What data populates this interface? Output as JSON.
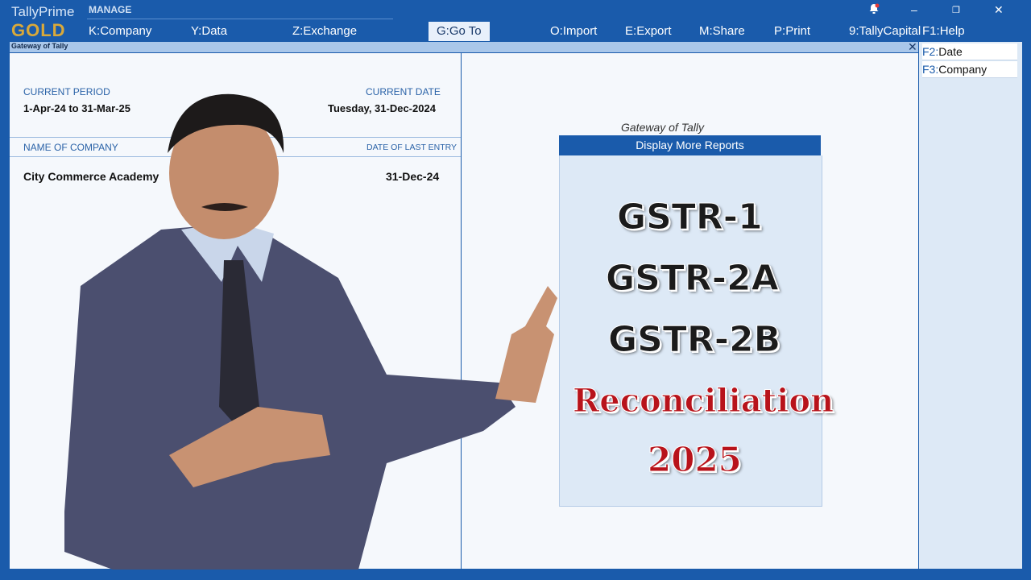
{
  "app": {
    "name": "TallyPrime",
    "edition": "GOLD"
  },
  "menu": {
    "section_label": "MANAGE",
    "items": [
      {
        "key": "K:",
        "label": "Company"
      },
      {
        "key": "Y:",
        "label": "Data"
      },
      {
        "key": "Z:",
        "label": "Exchange"
      },
      {
        "key": "G:",
        "label": "Go To"
      },
      {
        "key": "O:",
        "label": "Import"
      },
      {
        "key": "E:",
        "label": "Export"
      },
      {
        "key": "M:",
        "label": "Share"
      },
      {
        "key": "P:",
        "label": "Print"
      },
      {
        "key": "9:",
        "label": "TallyCapital"
      },
      {
        "key": "F1:",
        "label": "Help"
      }
    ]
  },
  "window_title": "Gateway of Tally",
  "right_panel": {
    "buttons": [
      {
        "key": "F2:",
        "label": "Date"
      },
      {
        "key": "F3:",
        "label": "Company"
      }
    ]
  },
  "left_panel": {
    "current_period_label": "CURRENT PERIOD",
    "current_period_value": "1-Apr-24 to 31-Mar-25",
    "current_date_label": "CURRENT DATE",
    "current_date_value": "Tuesday, 31-Dec-2024",
    "company_col_label": "NAME OF COMPANY",
    "last_entry_col_label": "DATE OF LAST ENTRY",
    "company_name": "City Commerce Academy",
    "last_entry_date": "31-Dec-24"
  },
  "gateway": {
    "title": "Gateway of Tally",
    "menu_header": "Display More Reports"
  },
  "overlay": {
    "line1": "GSTR-1",
    "line2": "GSTR-2A",
    "line3": "GSTR-2B",
    "line4": "Reconciliation",
    "line5": "2025"
  },
  "colors": {
    "accent": "#1a5bab",
    "gold": "#d9a93a",
    "headline_red": "#b8131b"
  }
}
